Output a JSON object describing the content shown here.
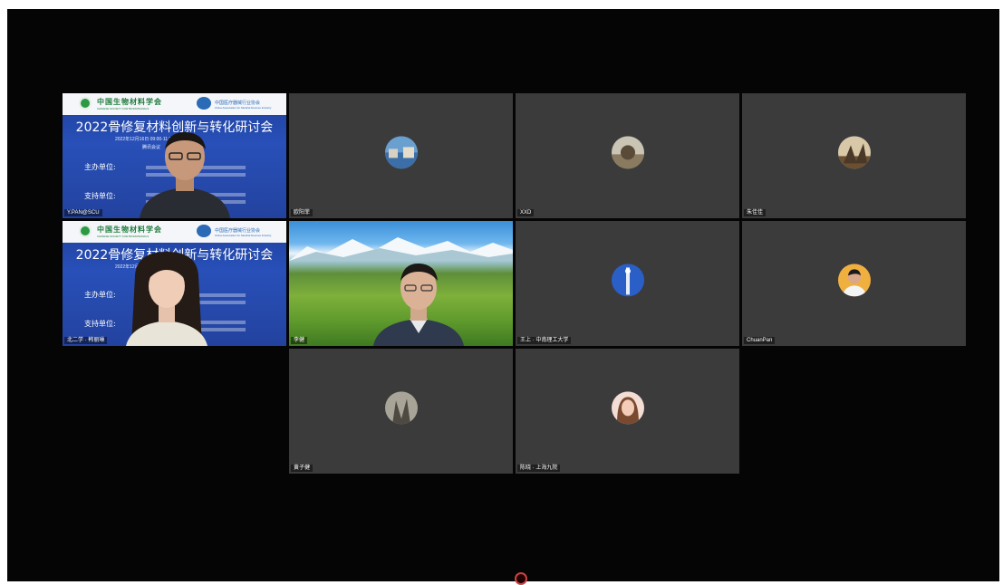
{
  "participants": [
    {
      "id": "t1",
      "name": "Y.PAN@SCU",
      "type": "slide-video"
    },
    {
      "id": "t2",
      "name": "欧阳菲",
      "type": "avatar"
    },
    {
      "id": "t3",
      "name": "XXD",
      "type": "avatar"
    },
    {
      "id": "t4",
      "name": "朱佳佳",
      "type": "avatar"
    },
    {
      "id": "t5",
      "name": "北二学 · 韩丽琳",
      "type": "slide-video"
    },
    {
      "id": "t6",
      "name": "李健",
      "type": "video"
    },
    {
      "id": "t7",
      "name": "王上 · 中南理工大学",
      "type": "avatar"
    },
    {
      "id": "t8",
      "name": "ChuanPan",
      "type": "avatar"
    },
    {
      "id": "t9",
      "name": "黄子健",
      "type": "avatar"
    },
    {
      "id": "t10",
      "name": "陈晓 · 上海九院",
      "type": "avatar"
    }
  ],
  "slide": {
    "org1_name": "中国生物材料学会",
    "org1_sub": "CHINESE SOCIETY FOR BIOMATERIALS",
    "org2_name": "中国医疗器械行业协会",
    "org2_sub": "China Association for Medical Devices Industry",
    "title": "2022骨修复材料创新与转化研讨会",
    "date_line": "2022年12月16日 09:00-11:15",
    "location": "腾讯会议",
    "host_label": "主办单位:",
    "support_label": "支持单位:"
  },
  "colors": {
    "background": "#050505",
    "tile": "#3b3b3c",
    "slide_blue": "#2850b8",
    "org_green": "#1e7a3a"
  }
}
